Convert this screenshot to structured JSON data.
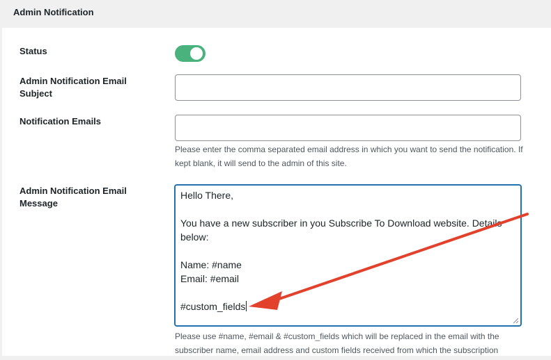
{
  "panel": {
    "title": "Admin Notification"
  },
  "fields": {
    "status": {
      "label": "Status",
      "enabled": true
    },
    "subject": {
      "label": "Admin Notification Email Subject",
      "value": "",
      "placeholder": ""
    },
    "emails": {
      "label": "Notification Emails",
      "value": "",
      "placeholder": "",
      "help": "Please enter the comma separated email address in which you want to send the notification. If kept blank, it will send to the admin of this site."
    },
    "message": {
      "label": "Admin Notification Email Message",
      "lines": {
        "greeting": "Hello There,",
        "body": "You have a new subscriber in you Subscribe To Download website. Details below:",
        "name": "Name: #name",
        "email": "Email: #email",
        "custom": "#custom_fields"
      },
      "help": "Please use #name, #email & #custom_fields which will be replaced in the email with the subscriber name, email address and custom fields received from which the subscription"
    }
  },
  "annotation": {
    "arrow_color": "#e2412c"
  },
  "colors": {
    "toggle_on": "#49b27d",
    "focus": "#2271b1"
  }
}
